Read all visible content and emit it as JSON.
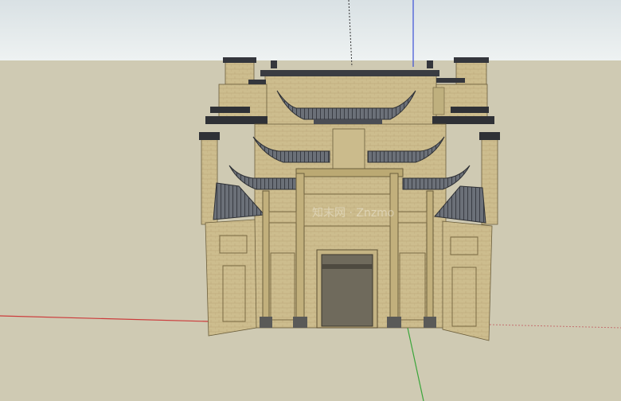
{
  "scene": {
    "colors": {
      "sky": "#e3e9eb",
      "ground": "#cfcab3",
      "wall": "#c9b98a",
      "wall_dark": "#a9976b",
      "roof_tile": "#5a5f66",
      "roof_dark": "#2f3136",
      "axis_red": "#cc3b3b",
      "axis_green": "#3aa53a",
      "axis_blue": "#3b50d6"
    },
    "watermark": "知末网 · Znzmo"
  }
}
